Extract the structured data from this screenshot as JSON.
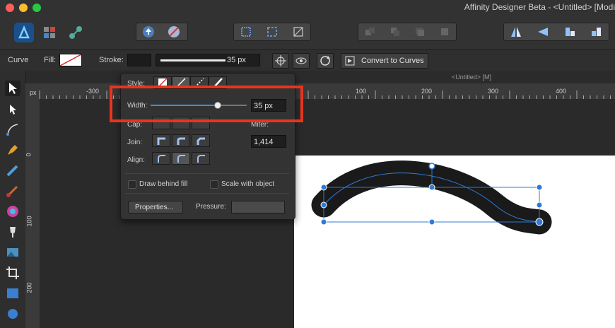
{
  "window": {
    "title": "Affinity Designer Beta - <Untitled> [Modi"
  },
  "context_bar": {
    "tool_label": "Curve",
    "fill_label": "Fill:",
    "stroke_label": "Stroke:",
    "stroke_width_value": "35 px",
    "convert_label": "Convert to Curves"
  },
  "document": {
    "tab_label": "<Untitled> [M]"
  },
  "ruler": {
    "unit": "px",
    "h_ticks": [
      "-300",
      "100",
      "200",
      "300",
      "400"
    ],
    "v_ticks": [
      "0",
      "100",
      "200"
    ]
  },
  "stroke_panel": {
    "style_label": "Style:",
    "width_label": "Width:",
    "width_value": "35 px",
    "width_level_fraction": 0.7,
    "cap_label": "Cap:",
    "miter_label": "Miter:",
    "miter_value": "1,414",
    "join_label": "Join:",
    "align_label": "Align:",
    "draw_behind_fill_label": "Draw behind fill",
    "scale_with_object_label": "Scale with object",
    "properties_label": "Properties...",
    "pressure_label": "Pressure:"
  },
  "colors": {
    "highlight": "#e8341e",
    "selection": "#2f7bd6",
    "stroke": "#1a1a1a"
  }
}
